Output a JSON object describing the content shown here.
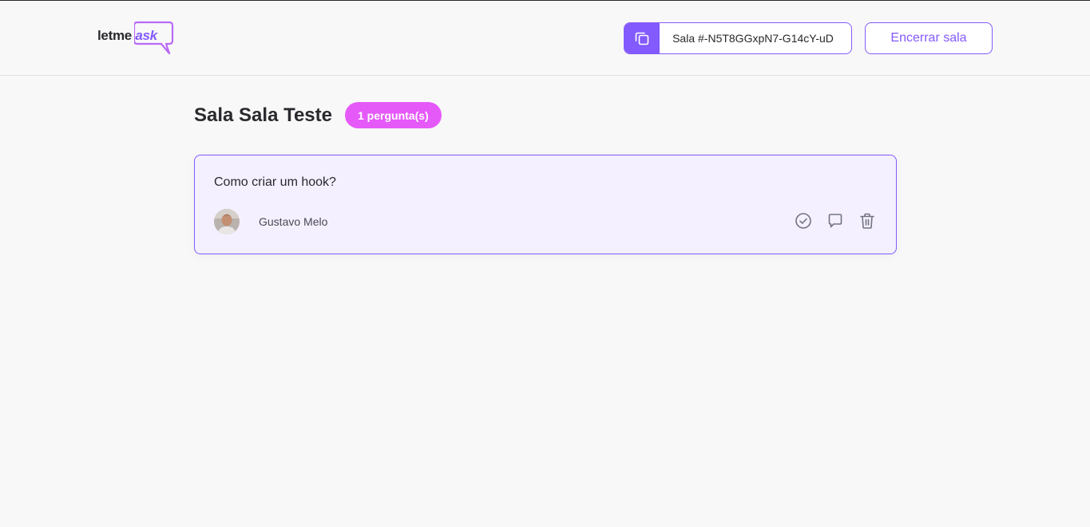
{
  "header": {
    "logo": {
      "text_prefix": "letme",
      "text_accent": "ask"
    },
    "room_code": {
      "copy_icon": "copy-icon",
      "label": "Sala #-N5T8GGxpN7-G14cY-uD"
    },
    "end_room_label": "Encerrar sala"
  },
  "room": {
    "title": "Sala Sala Teste",
    "question_count_badge": "1 pergunta(s)"
  },
  "questions": [
    {
      "content": "Como criar um hook?",
      "author": {
        "name": "Gustavo Melo",
        "avatar": "user-avatar"
      },
      "actions": [
        "check-circle-icon",
        "answer-icon",
        "trash-icon"
      ]
    }
  ],
  "colors": {
    "accent": "#835afd",
    "badge": "#e559f9",
    "card_bg": "#f4f0ff",
    "page_bg": "#f8f8f8"
  }
}
